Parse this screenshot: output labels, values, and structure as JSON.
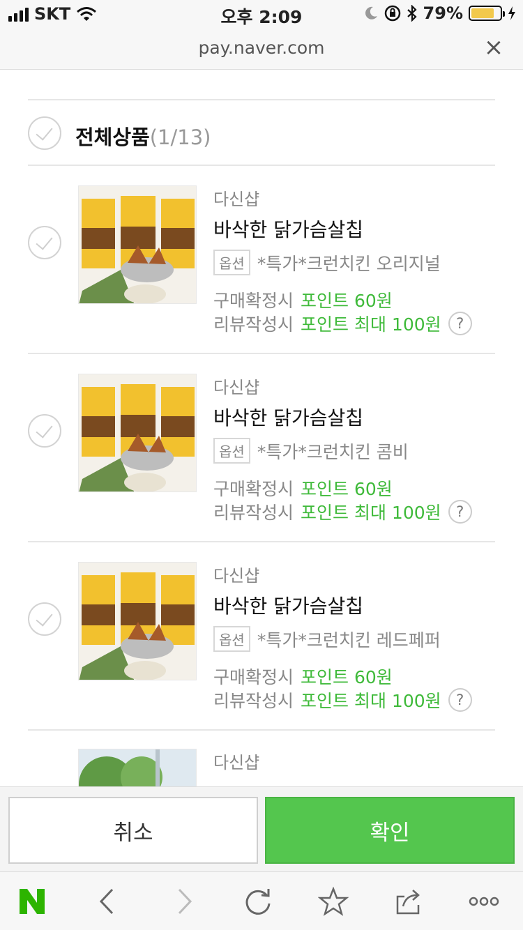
{
  "status_bar": {
    "carrier": "SKT",
    "time": "오후 2:09",
    "battery": "79%",
    "battery_level": 0.79
  },
  "browser": {
    "url": "pay.naver.com",
    "close_icon": "close-icon"
  },
  "select_all": {
    "label": "전체상품",
    "count": "(1/13)"
  },
  "items": [
    {
      "seller": "다신샵",
      "name": "바삭한 닭가슴살칩",
      "option_badge": "옵션",
      "option": "*특가*크런치킨 오리지널",
      "purchase_label": "구매확정시",
      "purchase_point": "포인트 60원",
      "review_label": "리뷰작성시",
      "review_point": "포인트 최대 100원",
      "help": "?"
    },
    {
      "seller": "다신샵",
      "name": "바삭한 닭가슴살칩",
      "option_badge": "옵션",
      "option": "*특가*크런치킨 콤비",
      "purchase_label": "구매확정시",
      "purchase_point": "포인트 60원",
      "review_label": "리뷰작성시",
      "review_point": "포인트 최대 100원",
      "help": "?"
    },
    {
      "seller": "다신샵",
      "name": "바삭한 닭가슴살칩",
      "option_badge": "옵션",
      "option": "*특가*크런치킨 레드페퍼",
      "purchase_label": "구매확정시",
      "purchase_point": "포인트 60원",
      "review_label": "리뷰작성시",
      "review_point": "포인트 최대 100원",
      "help": "?"
    },
    {
      "seller": "다신샵"
    }
  ],
  "buttons": {
    "cancel": "취소",
    "confirm": "확인"
  },
  "colors": {
    "accent_green": "#54c64e",
    "point_green": "#3fba3a",
    "naver_green": "#2db400"
  }
}
